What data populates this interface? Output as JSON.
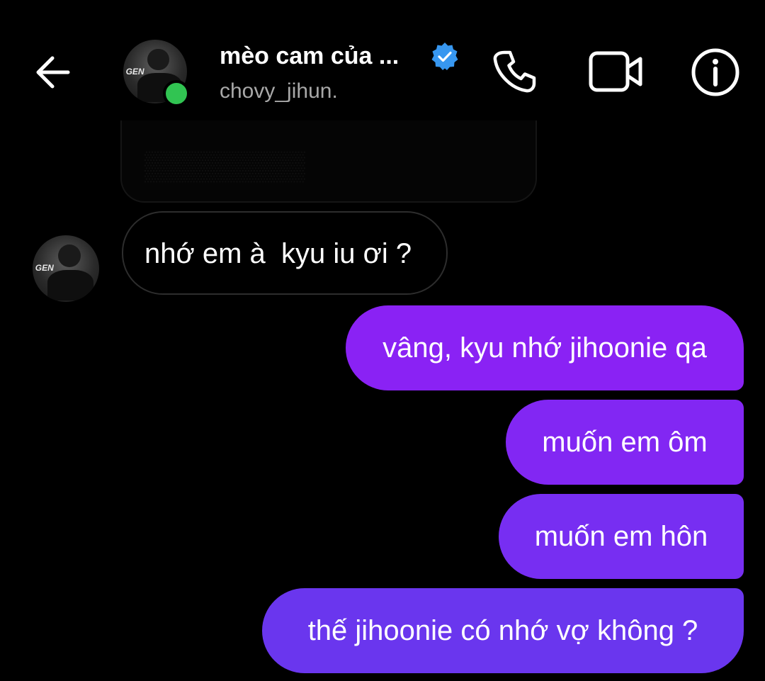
{
  "header": {
    "name": "mèo cam của ...",
    "username": "chovy_jihun.",
    "verified": true,
    "online": true,
    "icons": {
      "back": "arrow-left-icon",
      "call": "phone-icon",
      "video": "video-camera-icon",
      "info": "info-icon"
    }
  },
  "messages": {
    "received": [
      {
        "text": "nhớ em à  kyu iu ơi ?"
      }
    ],
    "sent": [
      {
        "text": "vâng, kyu nhớ jihoonie qa"
      },
      {
        "text": "muốn em ôm"
      },
      {
        "text": "muốn em hôn"
      },
      {
        "text": "thế jihoonie có nhớ vợ không ?"
      }
    ]
  },
  "colors": {
    "background": "#000000",
    "online": "#31c452",
    "verified": "#3797f0",
    "sent_gradient": [
      "#8a22f4",
      "#8227f3",
      "#772ef2",
      "#6a36ee"
    ],
    "received_border": "#2d2d2d"
  }
}
